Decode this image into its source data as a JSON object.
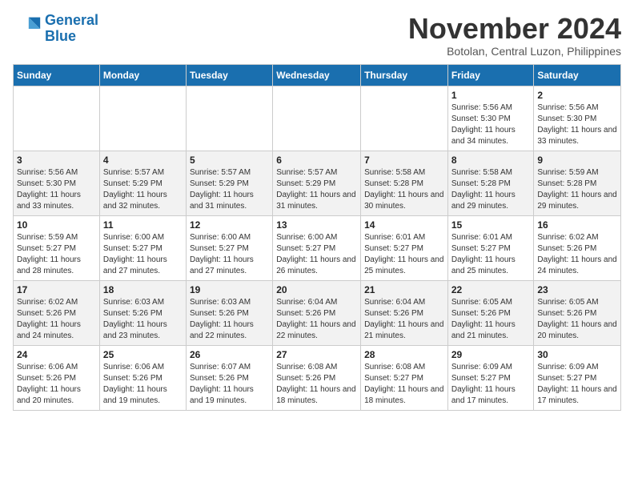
{
  "header": {
    "logo_line1": "General",
    "logo_line2": "Blue",
    "month": "November 2024",
    "location": "Botolan, Central Luzon, Philippines"
  },
  "weekdays": [
    "Sunday",
    "Monday",
    "Tuesday",
    "Wednesday",
    "Thursday",
    "Friday",
    "Saturday"
  ],
  "weeks": [
    [
      {
        "day": "",
        "info": ""
      },
      {
        "day": "",
        "info": ""
      },
      {
        "day": "",
        "info": ""
      },
      {
        "day": "",
        "info": ""
      },
      {
        "day": "",
        "info": ""
      },
      {
        "day": "1",
        "info": "Sunrise: 5:56 AM\nSunset: 5:30 PM\nDaylight: 11 hours and 34 minutes."
      },
      {
        "day": "2",
        "info": "Sunrise: 5:56 AM\nSunset: 5:30 PM\nDaylight: 11 hours and 33 minutes."
      }
    ],
    [
      {
        "day": "3",
        "info": "Sunrise: 5:56 AM\nSunset: 5:30 PM\nDaylight: 11 hours and 33 minutes."
      },
      {
        "day": "4",
        "info": "Sunrise: 5:57 AM\nSunset: 5:29 PM\nDaylight: 11 hours and 32 minutes."
      },
      {
        "day": "5",
        "info": "Sunrise: 5:57 AM\nSunset: 5:29 PM\nDaylight: 11 hours and 31 minutes."
      },
      {
        "day": "6",
        "info": "Sunrise: 5:57 AM\nSunset: 5:29 PM\nDaylight: 11 hours and 31 minutes."
      },
      {
        "day": "7",
        "info": "Sunrise: 5:58 AM\nSunset: 5:28 PM\nDaylight: 11 hours and 30 minutes."
      },
      {
        "day": "8",
        "info": "Sunrise: 5:58 AM\nSunset: 5:28 PM\nDaylight: 11 hours and 29 minutes."
      },
      {
        "day": "9",
        "info": "Sunrise: 5:59 AM\nSunset: 5:28 PM\nDaylight: 11 hours and 29 minutes."
      }
    ],
    [
      {
        "day": "10",
        "info": "Sunrise: 5:59 AM\nSunset: 5:27 PM\nDaylight: 11 hours and 28 minutes."
      },
      {
        "day": "11",
        "info": "Sunrise: 6:00 AM\nSunset: 5:27 PM\nDaylight: 11 hours and 27 minutes."
      },
      {
        "day": "12",
        "info": "Sunrise: 6:00 AM\nSunset: 5:27 PM\nDaylight: 11 hours and 27 minutes."
      },
      {
        "day": "13",
        "info": "Sunrise: 6:00 AM\nSunset: 5:27 PM\nDaylight: 11 hours and 26 minutes."
      },
      {
        "day": "14",
        "info": "Sunrise: 6:01 AM\nSunset: 5:27 PM\nDaylight: 11 hours and 25 minutes."
      },
      {
        "day": "15",
        "info": "Sunrise: 6:01 AM\nSunset: 5:27 PM\nDaylight: 11 hours and 25 minutes."
      },
      {
        "day": "16",
        "info": "Sunrise: 6:02 AM\nSunset: 5:26 PM\nDaylight: 11 hours and 24 minutes."
      }
    ],
    [
      {
        "day": "17",
        "info": "Sunrise: 6:02 AM\nSunset: 5:26 PM\nDaylight: 11 hours and 24 minutes."
      },
      {
        "day": "18",
        "info": "Sunrise: 6:03 AM\nSunset: 5:26 PM\nDaylight: 11 hours and 23 minutes."
      },
      {
        "day": "19",
        "info": "Sunrise: 6:03 AM\nSunset: 5:26 PM\nDaylight: 11 hours and 22 minutes."
      },
      {
        "day": "20",
        "info": "Sunrise: 6:04 AM\nSunset: 5:26 PM\nDaylight: 11 hours and 22 minutes."
      },
      {
        "day": "21",
        "info": "Sunrise: 6:04 AM\nSunset: 5:26 PM\nDaylight: 11 hours and 21 minutes."
      },
      {
        "day": "22",
        "info": "Sunrise: 6:05 AM\nSunset: 5:26 PM\nDaylight: 11 hours and 21 minutes."
      },
      {
        "day": "23",
        "info": "Sunrise: 6:05 AM\nSunset: 5:26 PM\nDaylight: 11 hours and 20 minutes."
      }
    ],
    [
      {
        "day": "24",
        "info": "Sunrise: 6:06 AM\nSunset: 5:26 PM\nDaylight: 11 hours and 20 minutes."
      },
      {
        "day": "25",
        "info": "Sunrise: 6:06 AM\nSunset: 5:26 PM\nDaylight: 11 hours and 19 minutes."
      },
      {
        "day": "26",
        "info": "Sunrise: 6:07 AM\nSunset: 5:26 PM\nDaylight: 11 hours and 19 minutes."
      },
      {
        "day": "27",
        "info": "Sunrise: 6:08 AM\nSunset: 5:26 PM\nDaylight: 11 hours and 18 minutes."
      },
      {
        "day": "28",
        "info": "Sunrise: 6:08 AM\nSunset: 5:27 PM\nDaylight: 11 hours and 18 minutes."
      },
      {
        "day": "29",
        "info": "Sunrise: 6:09 AM\nSunset: 5:27 PM\nDaylight: 11 hours and 17 minutes."
      },
      {
        "day": "30",
        "info": "Sunrise: 6:09 AM\nSunset: 5:27 PM\nDaylight: 11 hours and 17 minutes."
      }
    ]
  ]
}
